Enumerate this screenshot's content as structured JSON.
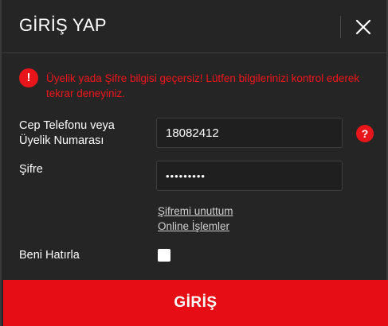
{
  "header": {
    "title": "GİRİŞ YAP",
    "close_icon": "close-icon"
  },
  "error": {
    "icon_symbol": "!",
    "message": "Üyelik yada Şifre bilgisi geçersiz! Lütfen bilgilerinizi kontrol ederek tekrar deneyiniz."
  },
  "form": {
    "phone_label_line1": "Cep Telefonu veya",
    "phone_label_line2": "Üyelik Numarası",
    "phone_value": "18082412",
    "help_symbol": "?",
    "password_label": "Şifre",
    "password_value": "•••••••••",
    "forgot_password_link": "Şifremi unuttum",
    "online_ops_link": "Online İşlemler",
    "remember_label": "Beni Hatırla",
    "remember_checked": false
  },
  "submit": {
    "label": "GİRİŞ"
  },
  "colors": {
    "accent_red": "#e60e14",
    "error_text": "#f0151b",
    "background": "#252525"
  }
}
